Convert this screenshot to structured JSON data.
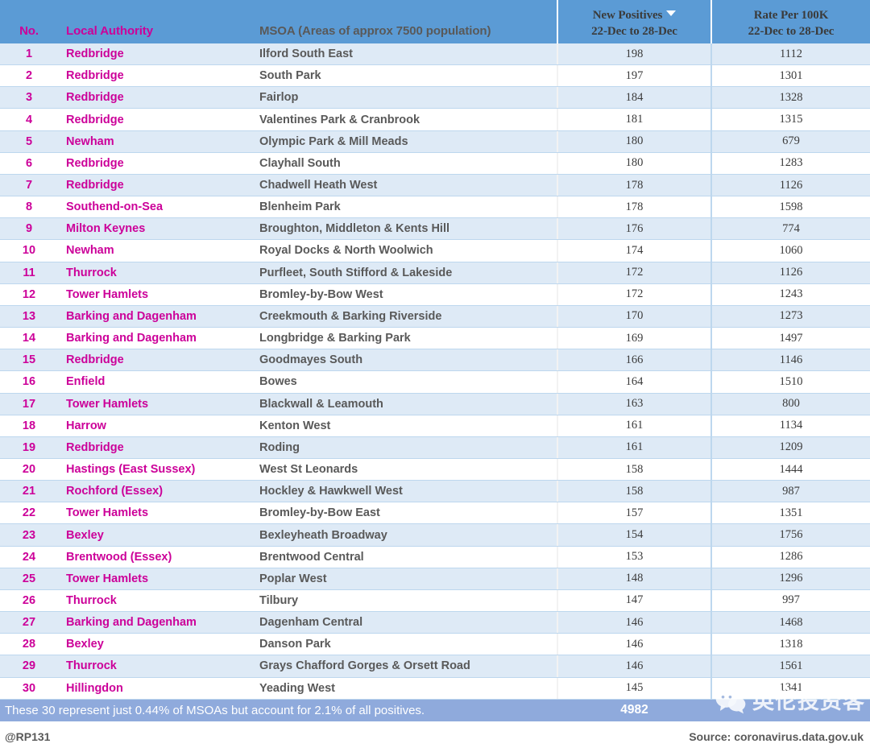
{
  "header": {
    "columns": [
      {
        "key": "no",
        "line1": "",
        "line2": "No."
      },
      {
        "key": "la",
        "line1": "",
        "line2": "Local Authority"
      },
      {
        "key": "msoa",
        "line1": "",
        "line2": "MSOA (Areas of approx 7500 population)"
      },
      {
        "key": "np",
        "line1": "New Positives",
        "line2": "22-Dec to 28-Dec",
        "sorted": true,
        "sort_icon": "caret-down-icon"
      },
      {
        "key": "rate",
        "line1": "Rate Per 100K",
        "line2": "22-Dec to 28-Dec"
      }
    ]
  },
  "rows": [
    {
      "no": "1",
      "la": "Redbridge",
      "msoa": "Ilford South East",
      "np": "198",
      "rate": "1112"
    },
    {
      "no": "2",
      "la": "Redbridge",
      "msoa": "South Park",
      "np": "197",
      "rate": "1301"
    },
    {
      "no": "3",
      "la": "Redbridge",
      "msoa": "Fairlop",
      "np": "184",
      "rate": "1328"
    },
    {
      "no": "4",
      "la": "Redbridge",
      "msoa": "Valentines Park & Cranbrook",
      "np": "181",
      "rate": "1315"
    },
    {
      "no": "5",
      "la": "Newham",
      "msoa": "Olympic Park & Mill Meads",
      "np": "180",
      "rate": "679"
    },
    {
      "no": "6",
      "la": "Redbridge",
      "msoa": "Clayhall South",
      "np": "180",
      "rate": "1283"
    },
    {
      "no": "7",
      "la": "Redbridge",
      "msoa": "Chadwell Heath West",
      "np": "178",
      "rate": "1126"
    },
    {
      "no": "8",
      "la": "Southend-on-Sea",
      "msoa": "Blenheim Park",
      "np": "178",
      "rate": "1598"
    },
    {
      "no": "9",
      "la": "Milton Keynes",
      "msoa": "Broughton, Middleton & Kents Hill",
      "np": "176",
      "rate": "774"
    },
    {
      "no": "10",
      "la": "Newham",
      "msoa": "Royal Docks & North Woolwich",
      "np": "174",
      "rate": "1060"
    },
    {
      "no": "11",
      "la": "Thurrock",
      "msoa": "Purfleet, South Stifford & Lakeside",
      "np": "172",
      "rate": "1126"
    },
    {
      "no": "12",
      "la": "Tower Hamlets",
      "msoa": "Bromley-by-Bow West",
      "np": "172",
      "rate": "1243"
    },
    {
      "no": "13",
      "la": "Barking and Dagenham",
      "msoa": "Creekmouth & Barking Riverside",
      "np": "170",
      "rate": "1273"
    },
    {
      "no": "14",
      "la": "Barking and Dagenham",
      "msoa": "Longbridge & Barking Park",
      "np": "169",
      "rate": "1497"
    },
    {
      "no": "15",
      "la": "Redbridge",
      "msoa": "Goodmayes South",
      "np": "166",
      "rate": "1146"
    },
    {
      "no": "16",
      "la": "Enfield",
      "msoa": "Bowes",
      "np": "164",
      "rate": "1510"
    },
    {
      "no": "17",
      "la": "Tower Hamlets",
      "msoa": "Blackwall & Leamouth",
      "np": "163",
      "rate": "800"
    },
    {
      "no": "18",
      "la": "Harrow",
      "msoa": "Kenton West",
      "np": "161",
      "rate": "1134"
    },
    {
      "no": "19",
      "la": "Redbridge",
      "msoa": "Roding",
      "np": "161",
      "rate": "1209"
    },
    {
      "no": "20",
      "la": "Hastings (East Sussex)",
      "msoa": "West St Leonards",
      "np": "158",
      "rate": "1444"
    },
    {
      "no": "21",
      "la": "Rochford (Essex)",
      "msoa": "Hockley & Hawkwell West",
      "np": "158",
      "rate": "987"
    },
    {
      "no": "22",
      "la": "Tower Hamlets",
      "msoa": "Bromley-by-Bow East",
      "np": "157",
      "rate": "1351"
    },
    {
      "no": "23",
      "la": "Bexley",
      "msoa": "Bexleyheath Broadway",
      "np": "154",
      "rate": "1756"
    },
    {
      "no": "24",
      "la": "Brentwood (Essex)",
      "msoa": "Brentwood Central",
      "np": "153",
      "rate": "1286"
    },
    {
      "no": "25",
      "la": "Tower Hamlets",
      "msoa": "Poplar West",
      "np": "148",
      "rate": "1296"
    },
    {
      "no": "26",
      "la": "Thurrock",
      "msoa": "Tilbury",
      "np": "147",
      "rate": "997"
    },
    {
      "no": "27",
      "la": "Barking and Dagenham",
      "msoa": "Dagenham Central",
      "np": "146",
      "rate": "1468"
    },
    {
      "no": "28",
      "la": "Bexley",
      "msoa": "Danson Park",
      "np": "146",
      "rate": "1318"
    },
    {
      "no": "29",
      "la": "Thurrock",
      "msoa": "Grays Chafford Gorges & Orsett Road",
      "np": "146",
      "rate": "1561"
    },
    {
      "no": "30",
      "la": "Hillingdon",
      "msoa": "Yeading West",
      "np": "145",
      "rate": "1341"
    }
  ],
  "summary": {
    "text": "These 30 represent just 0.44% of MSOAs but account for 2.1% of all positives.",
    "total": "4982"
  },
  "footer": {
    "handle": "@RP131",
    "source": "Source: coronavirus.data.gov.uk"
  },
  "watermark": {
    "logo": "wechat-logo-icon",
    "text": "英伦投资客"
  },
  "colors": {
    "header_blue": "#5B9BD5",
    "row_alt": "#DEEAF6",
    "row_border": "#BDD7EE",
    "magenta": "#CC0099",
    "dark_text": "#595959",
    "summary_bar": "#8FAADC"
  }
}
